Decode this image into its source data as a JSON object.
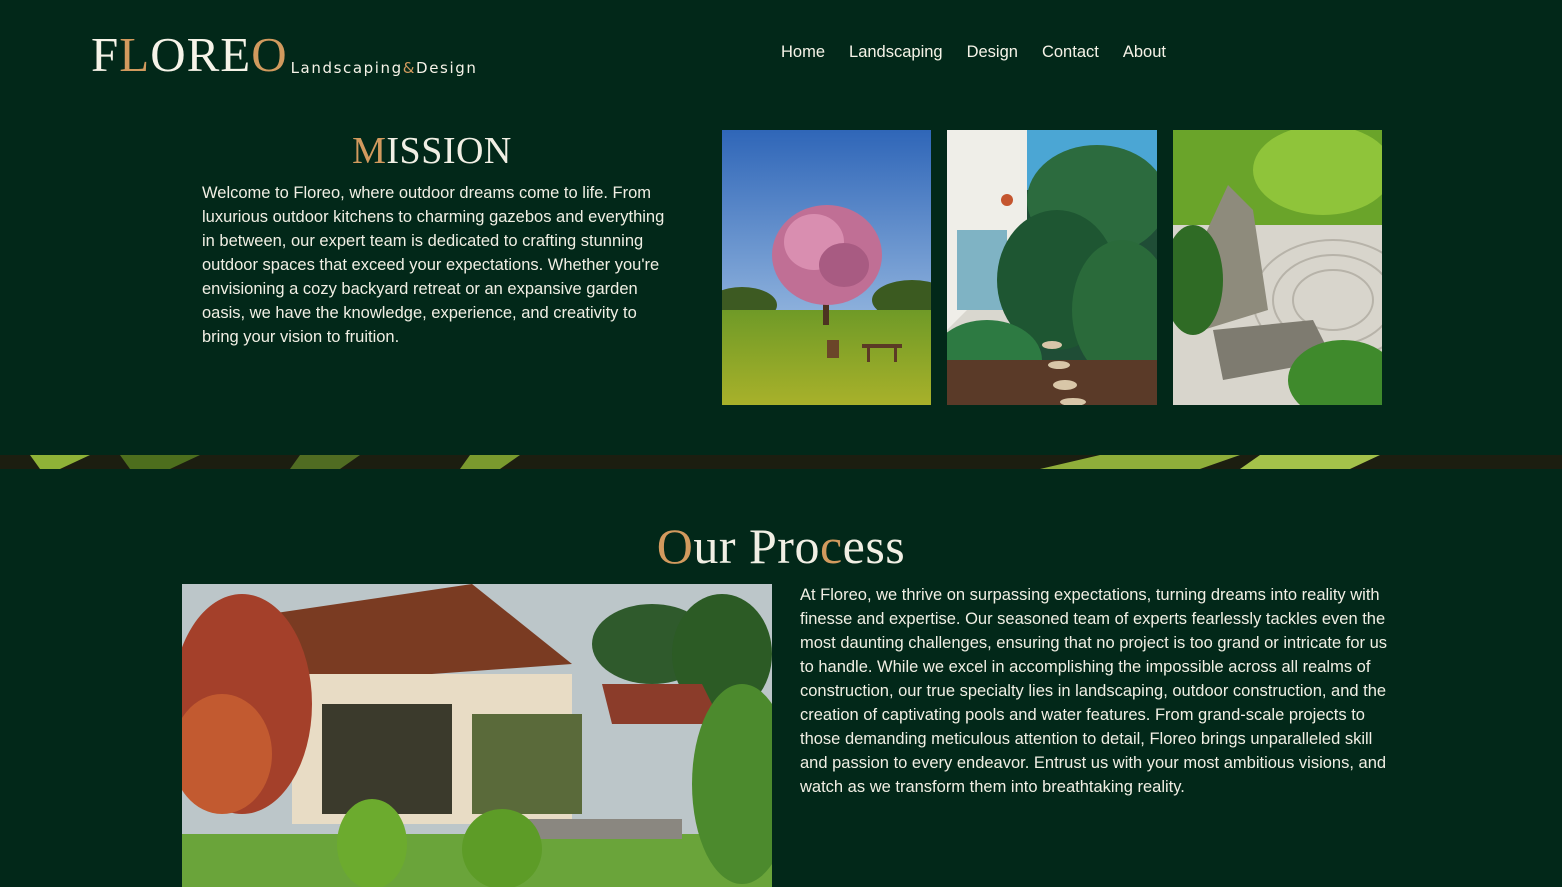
{
  "brand": {
    "logo_parts": [
      "F",
      "L",
      "ORE",
      "O"
    ],
    "tagline_parts": [
      "Landscaping",
      "&",
      "Design"
    ],
    "accent_color": "#d29a5e",
    "background_color": "#022819"
  },
  "nav": {
    "items": [
      "Home",
      "Landscaping",
      "Design",
      "Contact",
      "About"
    ]
  },
  "mission": {
    "title_initial": "M",
    "title_rest": "ISSION",
    "body": "Welcome to Floreo, where outdoor dreams come to life. From luxurious outdoor kitchens to charming gazebos and everything in between, our expert team is dedicated to crafting stunning outdoor spaces that exceed your expectations. Whether you're envisioning a cozy backyard retreat or an expansive garden oasis, we have the knowledge, experience, and creativity to bring your vision to fruition."
  },
  "process": {
    "title_parts": [
      "O",
      "ur Pro",
      "c",
      "ess"
    ],
    "body": "At Floreo, we thrive on surpassing expectations, turning dreams into reality with finesse and expertise. Our seasoned team of experts fearlessly tackles even the most daunting challenges, ensuring that no project is too grand or intricate for us to handle. While we excel in accomplishing the impossible across all realms of construction, our true specialty lies in landscaping, outdoor construction, and the creation of captivating pools and water features. From grand-scale projects to those demanding meticulous attention to detail, Floreo brings unparalleled skill and passion to every endeavor. Entrust us with your most ambitious visions, and watch as we transform them into breathtaking reality."
  }
}
